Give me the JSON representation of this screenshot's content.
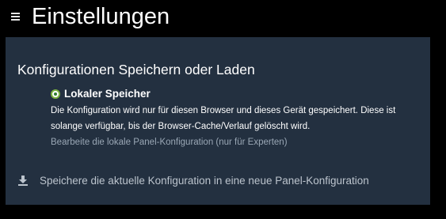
{
  "header": {
    "title": "Einstellungen",
    "menu_icon": "hamburger-menu-icon"
  },
  "panel": {
    "section_title": "Konfigurationen Speichern oder Laden",
    "option": {
      "label": "Lokaler Speicher",
      "selected": true,
      "description": "Die Konfiguration wird nur für diesen Browser und dieses Gerät gespeichert. Diese ist solange verfügbar, bis der Browser-Cache/Verlauf gelöscht wird.",
      "link": "Bearbeite die lokale Panel-Konfiguration (nur für Experten)"
    },
    "save_action": {
      "icon": "download-icon",
      "label": "Speichere die aktuelle Konfiguration in eine neue Panel-Konfiguration"
    }
  },
  "colors": {
    "background": "#000000",
    "panel": "#233040",
    "radio_accent": "#7cb342",
    "muted_text": "#9aa7b5"
  }
}
